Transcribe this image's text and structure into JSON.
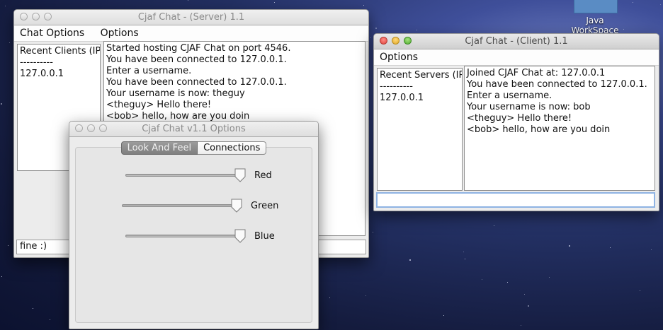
{
  "desktop": {
    "icon_label": "Java",
    "icon_label_2": "WorkSpace"
  },
  "server_window": {
    "title": "Cjaf Chat - (Server) 1.1",
    "menu": [
      "Chat Options",
      "Options"
    ],
    "recent_clients": {
      "header": "Recent Clients (IP)",
      "separator": "----------",
      "items": [
        "127.0.0.1"
      ]
    },
    "messages": [
      "Started hosting CJAF Chat on port 4546.",
      "You have been connected to 127.0.0.1.",
      "Enter a username.",
      "You have been connected to 127.0.0.1.",
      "Your username is now: theguy",
      "<theguy> Hello there!",
      "<bob> hello, how are you doin"
    ],
    "input_value": "fine :)"
  },
  "options_window": {
    "title": "Cjaf Chat v1.1 Options",
    "tabs": [
      "Look And Feel",
      "Connections"
    ],
    "selected_tab": "Look And Feel",
    "sliders": [
      {
        "label": "Red",
        "value": 1.0
      },
      {
        "label": "Green",
        "value": 1.0
      },
      {
        "label": "Blue",
        "value": 1.0
      }
    ]
  },
  "client_window": {
    "title": "Cjaf Chat - (Client) 1.1",
    "menu": [
      "Options"
    ],
    "recent_servers": {
      "header": "Recent Servers (IP)",
      "separator": "----------",
      "items": [
        "127.0.0.1"
      ]
    },
    "messages": [
      "Joined CJAF Chat at: 127.0.0.1",
      "You have been connected to 127.0.0.1.",
      "Enter a username.",
      "Your username is now: bob",
      "<theguy> Hello there!",
      "<bob> hello, how are you doin"
    ],
    "input_value": ""
  }
}
